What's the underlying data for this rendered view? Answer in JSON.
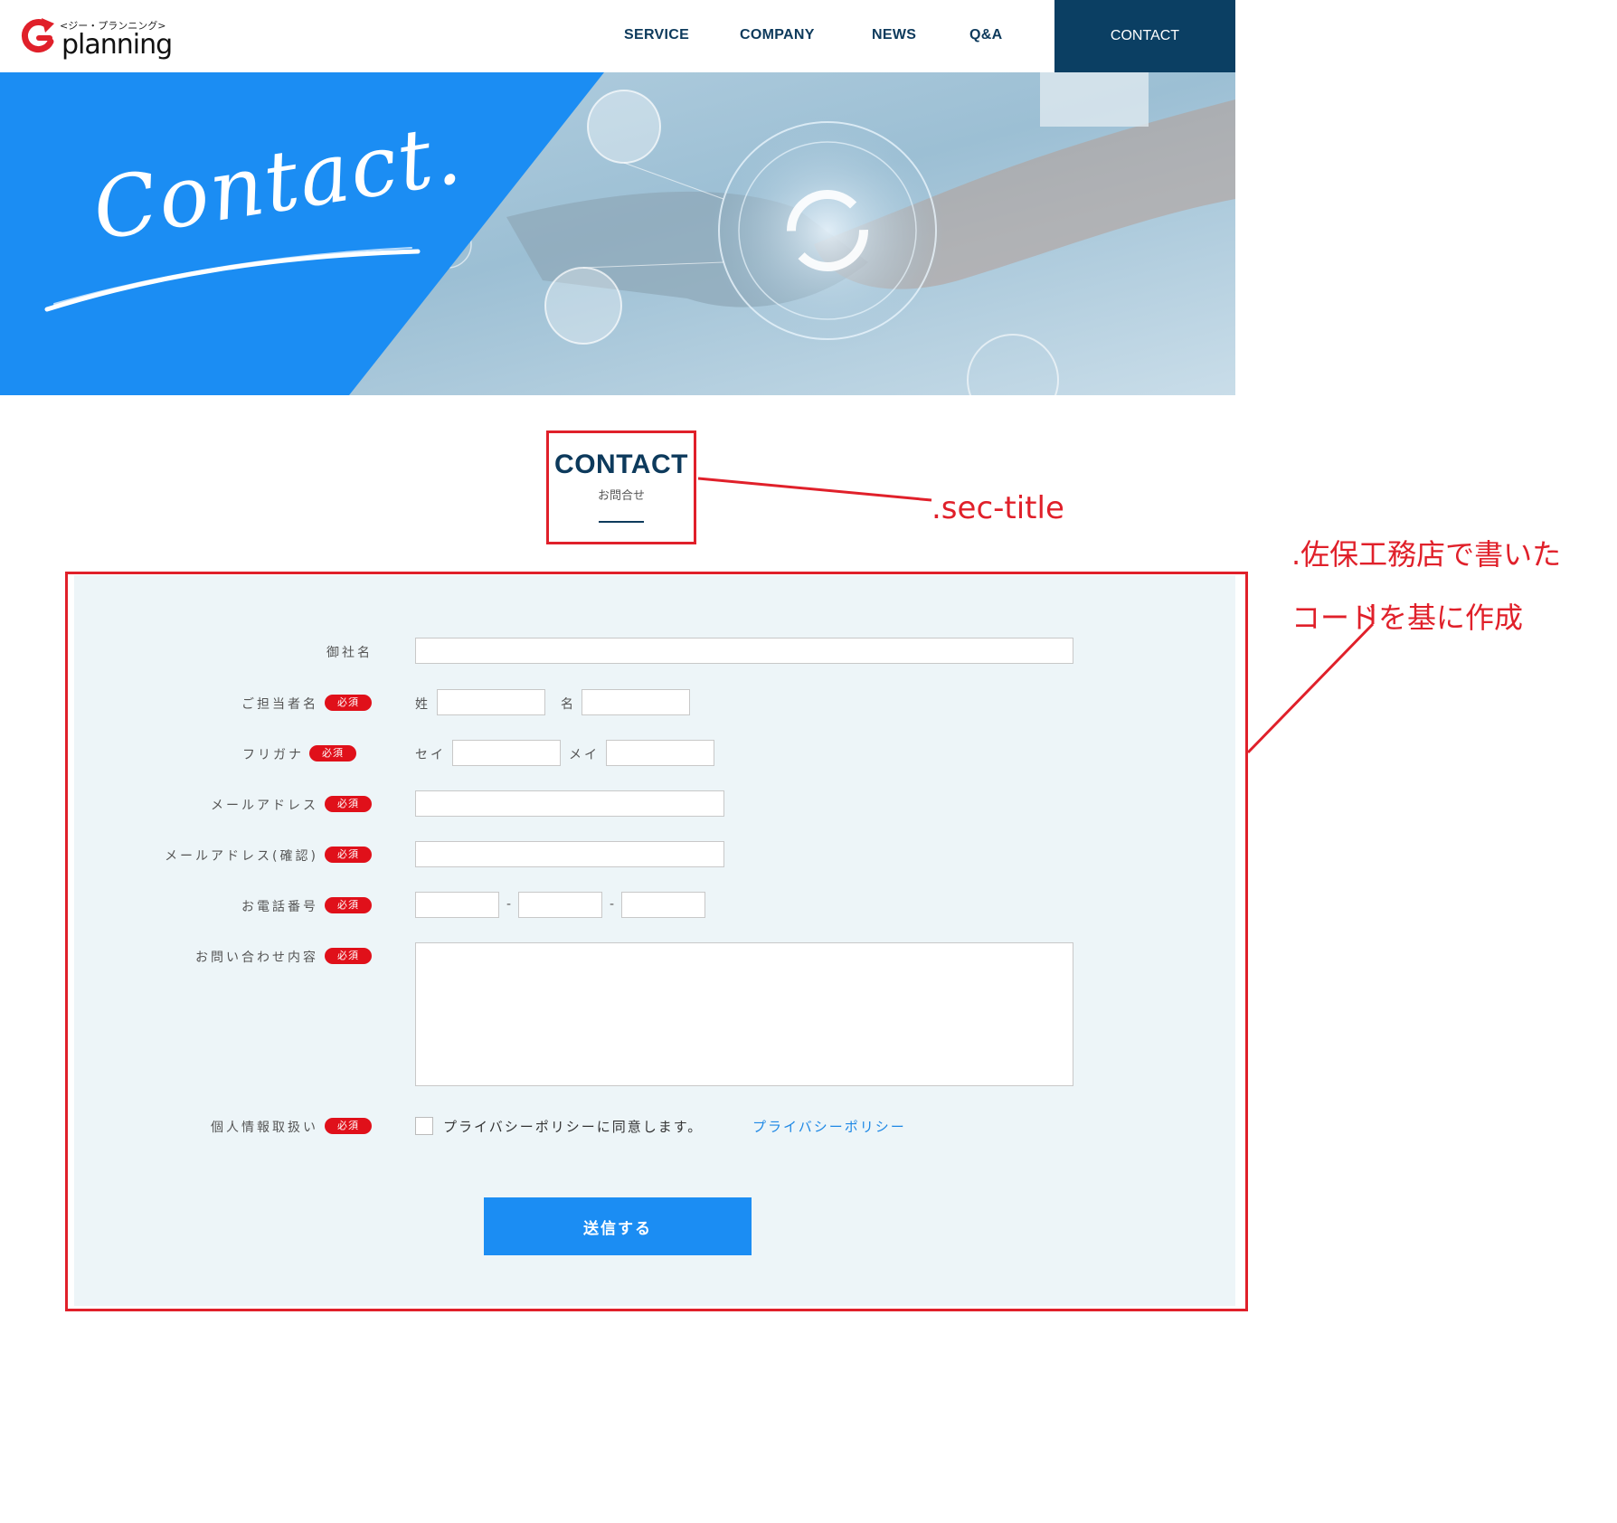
{
  "header": {
    "logo_small": "<ジー・プランニング>",
    "logo_word": "planning",
    "nav": [
      {
        "label": "SERVICE"
      },
      {
        "label": "COMPANY"
      },
      {
        "label": "NEWS"
      },
      {
        "label": "Q&A"
      }
    ],
    "contact_label": "CONTACT",
    "colors": {
      "nav_text": "#0d3a5c",
      "contact_bg": "#0b3f63"
    }
  },
  "hero": {
    "script_text": "Contact.",
    "colors": {
      "panel": "#1b8df3"
    }
  },
  "sec_title": {
    "en": "CONTACT",
    "ja": "お問合せ"
  },
  "annotations": {
    "sec_title_note": ".sec-title",
    "form_note_line1": ".佐保工務店で書いた",
    "form_note_line2": "コードを基に作成",
    "color": "#e0202a"
  },
  "form": {
    "required_label": "必須",
    "company_label": "御社名",
    "contact_person_label": "ご担当者名",
    "last_name_label": "姓",
    "first_name_label": "名",
    "furigana_label": "フリガナ",
    "sei_label": "セイ",
    "mei_label": "メイ",
    "email_label": "メールアドレス",
    "email_confirm_label": "メールアドレス(確認)",
    "phone_label": "お電話番号",
    "phone_separator": "-",
    "inquiry_label": "お問い合わせ内容",
    "privacy_label": "個人情報取扱い",
    "agree_text": "プライバシーポリシーに同意します。",
    "privacy_link": "プライバシーポリシー",
    "submit_label": "送信する",
    "colors": {
      "background": "#edf5f8",
      "required": "#e0101a",
      "submit": "#1b8df3",
      "link": "#1e88e5"
    }
  }
}
